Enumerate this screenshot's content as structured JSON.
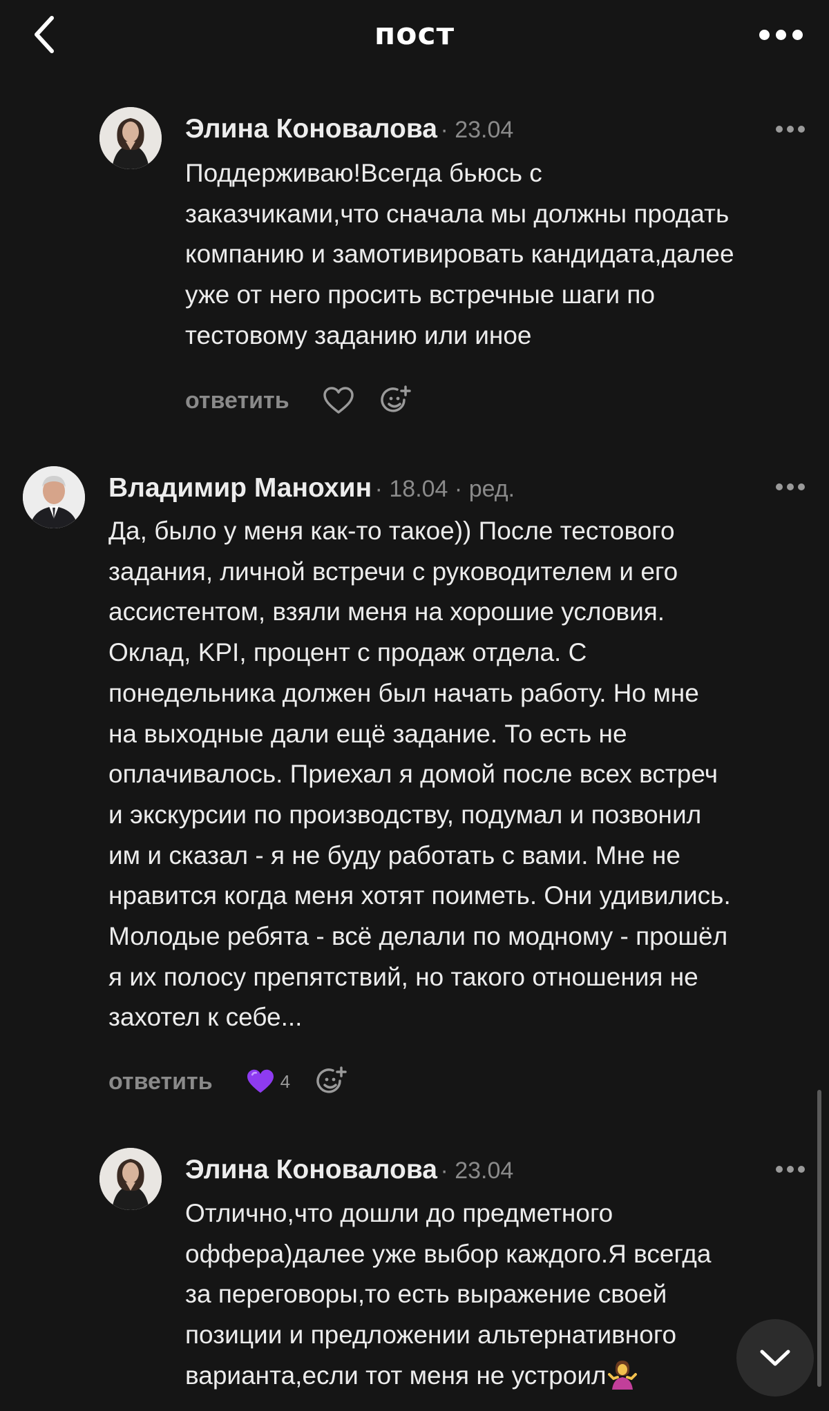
{
  "header": {
    "title": "пост",
    "back_icon": "chevron-left-icon",
    "more_icon": "more-horizontal-icon"
  },
  "comments": [
    {
      "author": "Элина Коновалова",
      "date": "23.04",
      "edited": "",
      "lines": [
        "Поддерживаю!Всегда бьюсь с",
        "заказчиками,что сначала мы должны продать",
        "компанию и замотивировать кандидата,далее",
        "уже от него просить встречные шаги по",
        "тестовому заданию или иное"
      ],
      "reply_label": "ответить",
      "liked": false,
      "likes": ""
    },
    {
      "author": "Владимир Манохин",
      "date": "18.04",
      "edited": "ред.",
      "lines": [
        "Да, было у меня как-то такое)) После тестового",
        "задания, личной встречи с руководителем и его",
        "ассистентом, взяли меня на хорошие условия.",
        "Оклад, KPI, процент с продаж отдела. С",
        "понедельника должен был начать работу. Но мне",
        "на выходные дали ещё задание. То есть не",
        "оплачивалось. Приехал я домой после всех встреч",
        "и экскурсии по производству, подумал и позвонил",
        "им и сказал - я не буду работать с вами. Мне не",
        "нравится когда меня хотят поиметь. Они удивились.",
        "Молодые ребята - всё делали по модному - прошёл",
        "я их полосу препятствий, но такого отношения не",
        "захотел к себе..."
      ],
      "reply_label": "ответить",
      "liked": true,
      "likes": "4"
    },
    {
      "author": "Элина Коновалова",
      "date": "23.04",
      "edited": "",
      "lines": [
        "Отлично,что дошли до предметного",
        "оффера)далее уже выбор каждого.Я всегда",
        "за переговоры,то есть выражение своей",
        "позиции и предложении альтернативного",
        "варианта,если тот меня не устроил"
      ],
      "reply_label": "",
      "liked": false,
      "likes": ""
    }
  ],
  "colors": {
    "background": "#151515",
    "text": "#ECECEC",
    "muted": "#8A8A8A",
    "like_purple": "#8E3BF0"
  }
}
